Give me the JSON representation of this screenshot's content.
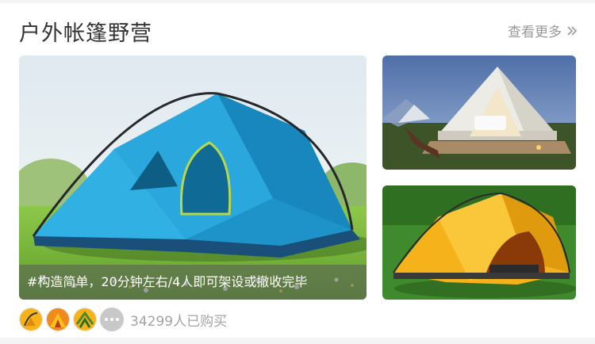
{
  "section": {
    "title": "户外帐篷野营",
    "more_label": "查看更多"
  },
  "hero": {
    "caption": "#构造简单，20分钟左右/4人即可架设或撤收完毕"
  },
  "buyers": {
    "count_text": "34299人已购买"
  },
  "colors": {
    "title": "#333333",
    "muted": "#999999",
    "tent_blue": "#2aa8dd",
    "tent_yellow": "#f6b21a"
  },
  "icons": [
    "chevron-double-right-icon",
    "more-dots-icon"
  ]
}
